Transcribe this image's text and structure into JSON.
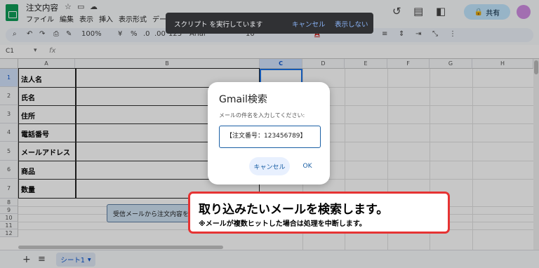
{
  "doc": {
    "title": "注文内容"
  },
  "menu": [
    "ファイル",
    "編集",
    "表示",
    "挿入",
    "表示形式",
    "データ"
  ],
  "topbar": {
    "share_label": "共有",
    "share_icon": "lock-icon"
  },
  "toolbar": {
    "zoom": "100%",
    "currency": "¥",
    "percent": "%",
    "decimal_less": ".0",
    "decimal_more": ".00",
    "number_format": "123",
    "font": "Arial",
    "font_size": "10"
  },
  "formula_bar": {
    "cell_ref": "C1",
    "fx": "fx"
  },
  "columns": [
    "A",
    "B",
    "C",
    "D",
    "E",
    "F",
    "G",
    "H"
  ],
  "rows": [
    "1",
    "2",
    "3",
    "4",
    "5",
    "6",
    "7",
    "8",
    "9",
    "10",
    "11",
    "12"
  ],
  "labels": [
    "法人名",
    "氏名",
    "住所",
    "電話番号",
    "メールアドレス",
    "商品",
    "数量"
  ],
  "sheet_button": "受信メールから注文内容を",
  "sheet_tab": "シート1",
  "snackbar": {
    "text": "スクリプト を実行しています",
    "cancel": "キャンセル",
    "hide": "表示しない"
  },
  "dialog": {
    "title": "Gmail検索",
    "prompt": "メールの件名を入力してください:",
    "input_value": "【注文番号：123456789】",
    "cancel": "キャンセル",
    "ok": "OK"
  },
  "callout": {
    "main": "取り込みたいメールを検索します。",
    "sub": "※メールが複数ヒットした場合は処理を中断します。"
  }
}
